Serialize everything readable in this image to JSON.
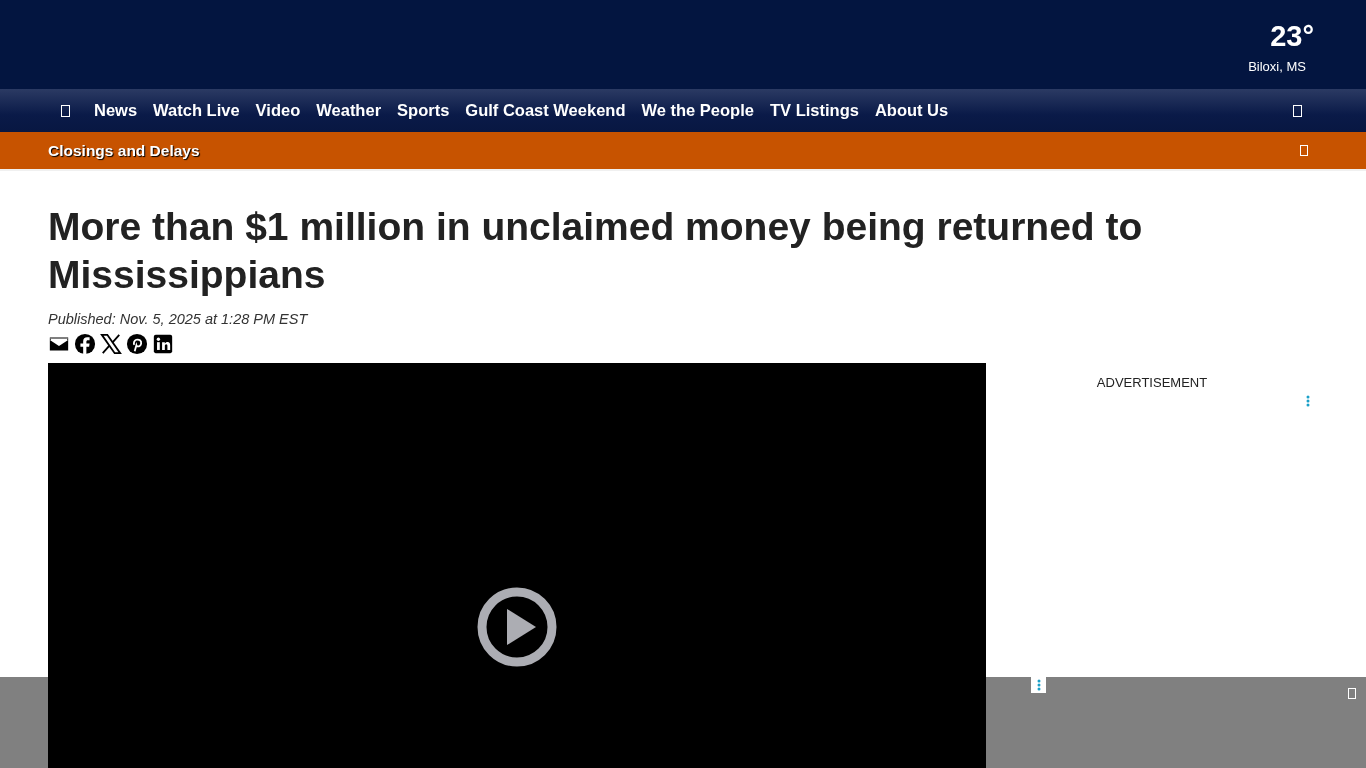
{
  "header": {
    "temperature": "23°",
    "location": "Biloxi, MS"
  },
  "nav": {
    "items": [
      "News",
      "Watch Live",
      "Video",
      "Weather",
      "Sports",
      "Gulf Coast Weekend",
      "We the People",
      "TV Listings",
      "About Us"
    ]
  },
  "alert_bar": {
    "label": "Closings and Delays"
  },
  "article": {
    "title": "More than $1 million in unclaimed money being returned to Mississippians",
    "published": "Published: Nov. 5, 2025 at 1:28 PM EST",
    "video": {
      "kind": "player"
    }
  },
  "sidebar": {
    "ad_label": "ADVERTISEMENT"
  }
}
